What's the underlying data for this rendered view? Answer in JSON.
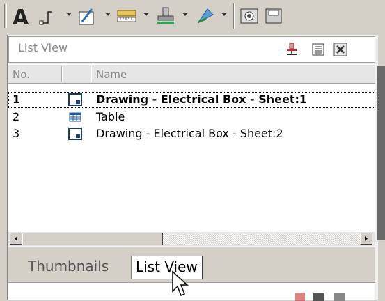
{
  "toolbar": {
    "buttons": [
      "text-tool-icon",
      "dimension-icon",
      "draw-icon",
      "ruler-icon",
      "stamp-icon",
      "callout-icon",
      "camera-icon",
      "save-icon"
    ]
  },
  "list_view": {
    "title": "List View",
    "columns": [
      "No.",
      "",
      "Name"
    ],
    "rows": [
      {
        "no": "1",
        "icon": "drawing-sheet-icon",
        "name": "Drawing - Electrical Box - Sheet:1",
        "selected": true
      },
      {
        "no": "2",
        "icon": "table-icon",
        "name": "Table",
        "selected": false
      },
      {
        "no": "3",
        "icon": "drawing-sheet-icon",
        "name": "Drawing - Electrical Box - Sheet:2",
        "selected": false
      }
    ]
  },
  "tabs": [
    {
      "label": "Thumbnails",
      "active": false
    },
    {
      "label": "List View",
      "active": true
    }
  ],
  "colors": {
    "selection_outline": "#000000",
    "panel_bg": "#d4d0c8"
  }
}
